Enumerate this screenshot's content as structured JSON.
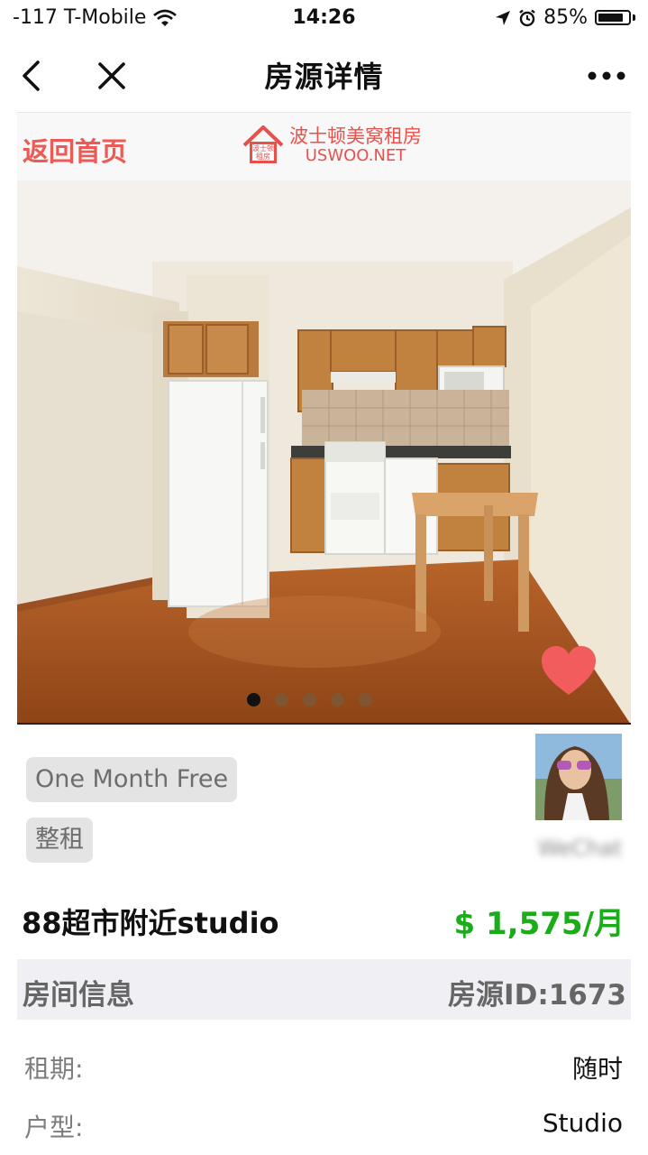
{
  "status_bar": {
    "carrier": "-117 T-Mobile",
    "time": "14:26",
    "battery": "85%",
    "battery_level": 0.85
  },
  "nav": {
    "title": "房源详情"
  },
  "banner": {
    "home_link": "返回首页",
    "logo_cn": "波士顿美窝租房",
    "logo_en": "USWOO.NET",
    "logo_badge": "波士顿租房"
  },
  "gallery": {
    "photo_count": 5,
    "active_index": 0,
    "favorite_color": "#f25c5c"
  },
  "tags": [
    "One Month Free",
    "整租"
  ],
  "agent": {
    "wechat_label": "WeChat"
  },
  "listing": {
    "title": "88超市附近studio",
    "price": "$ 1,575/月"
  },
  "room_info": {
    "title": "房间信息",
    "id_text": "房源ID:1673",
    "rows": [
      {
        "label": "租期:",
        "value": "随时"
      },
      {
        "label": "户型:",
        "value": "Studio"
      }
    ]
  },
  "colors": {
    "accent_red": "#ec5a56",
    "price_green": "#1aad19",
    "section_bg": "#efeff4"
  }
}
